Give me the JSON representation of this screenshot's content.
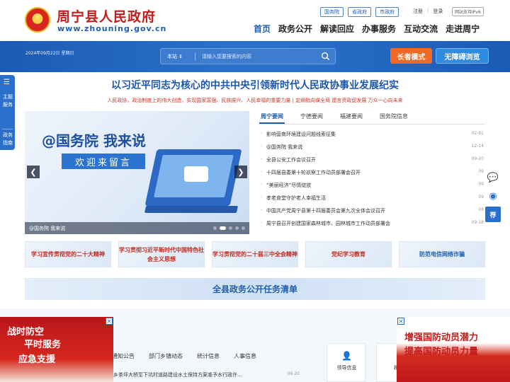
{
  "header": {
    "site_name": "周宁县人民政府",
    "site_domain": "www.zhouning.gov.cn",
    "top_links": [
      "国务院",
      "省政府",
      "市政府"
    ],
    "auth": [
      "注册",
      "登录"
    ],
    "ipv6": "网站支持IPv6",
    "nav": [
      "首页",
      "政务公开",
      "解读回应",
      "办事服务",
      "互动交流",
      "走进周宁"
    ]
  },
  "band": {
    "date": "2024年09月22日 星期日",
    "search_scope": "本站",
    "search_placeholder": "请输入您要搜索的内容",
    "elder_mode": "长者模式",
    "accessible": "无障碍浏览"
  },
  "left_side": {
    "item1": "主题服务",
    "item2": "政务指南"
  },
  "headline": "以习近平同志为核心的中共中央引领新时代人民政协事业发展纪实",
  "subline": "人民政协，政治制度上的伟大创造，实现国家富强、民族振兴、人民幸福的重要力量 | 定纲指向谋全局 建言资政促发展 万众一心向未来",
  "slider": {
    "title": "@国务院 我来说",
    "subtitle": "欢迎来留言",
    "caption": "@国务院 我来说"
  },
  "news": {
    "tabs": [
      "周宁要闻",
      "宁德要闻",
      "福建要闻",
      "国务院信息"
    ],
    "items": [
      {
        "title": "影响营商环境建设问题线索征集",
        "date": "02-01"
      },
      {
        "title": "@国务院 我来说",
        "date": "12-14"
      },
      {
        "title": "全县公安工作会议召开",
        "date": "09-20"
      },
      {
        "title": "十四届县委第十轮巡察工作动员部署会召开",
        "date": "09"
      },
      {
        "title": "“美丽经济”尽情绽放",
        "date": "09"
      },
      {
        "title": "孝老食堂守护老人幸福生活",
        "date": "09"
      },
      {
        "title": "中国共产党周宁县第十四届委员会第九次全体会议召开",
        "date": "09"
      },
      {
        "title": "周宁县召开创建国家森林城市、园林城市工作动员部署会",
        "date": "09-18"
      }
    ]
  },
  "topics": [
    "学习宣传贯彻党的二十大精神",
    "学习贯彻习近平新时代中国特色社会主义思想",
    "学习贯彻党的二十届三中全会精神",
    "党纪学习教育",
    "防范电信网络诈骗"
  ],
  "task_bar": "全县政务公开任务清单",
  "bottom": {
    "tabs": [
      "通知公告",
      "部门乡镇动态",
      "统计信息",
      "人事信息"
    ],
    "news": {
      "title": "乡茶坪大桥至下坑村道路建设水土保持方案准予水行政许...",
      "date": "09-20"
    },
    "services": [
      "领导信息",
      "机"
    ]
  },
  "float_left": {
    "l1": "战时防空",
    "l2": "平时服务",
    "l3": "应急支援"
  },
  "float_right": {
    "l1": "增强国防动员潜力",
    "l2": "提高国防动员力量"
  },
  "right_side": {
    "text": "荐"
  }
}
